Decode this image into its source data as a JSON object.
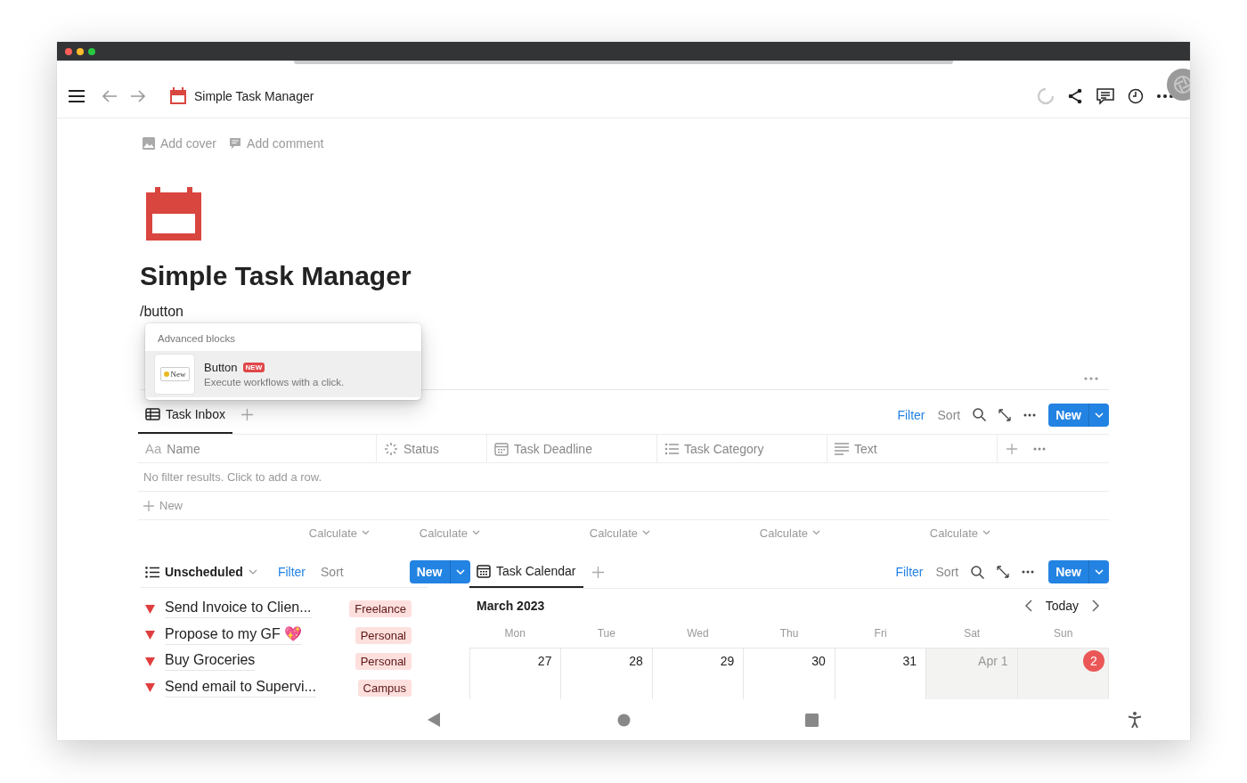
{
  "window": {
    "title": "Simple Task Manager"
  },
  "page_actions": [
    {
      "kind": "cover",
      "label": "Add cover"
    },
    {
      "kind": "comment",
      "label": "Add comment"
    }
  ],
  "page": {
    "title": "Simple Task Manager",
    "typed_command": "/button"
  },
  "block_menu": {
    "section": "Advanced blocks",
    "items": [
      {
        "title": "Button",
        "badge": "NEW",
        "description": "Execute workflows with a click.",
        "preview_label": "New",
        "selected": true
      }
    ]
  },
  "inbox": {
    "tabs": [
      {
        "label": "Task Inbox",
        "selected": true
      }
    ],
    "filter": "Filter",
    "sort": "Sort",
    "new": "New",
    "columns": [
      {
        "kind": "title",
        "prefix": "Aa",
        "label": "Name"
      },
      {
        "kind": "status",
        "label": "Status"
      },
      {
        "kind": "date",
        "label": "Task Deadline"
      },
      {
        "kind": "multi",
        "label": "Task Category"
      },
      {
        "kind": "text",
        "label": "Text"
      }
    ],
    "empty_message": "No filter results. Click to add a row.",
    "add_row": "New",
    "calculate": [
      "Calculate",
      "Calculate",
      "Calculate",
      "Calculate",
      "Calculate"
    ]
  },
  "unscheduled": {
    "view": "Unscheduled",
    "filter": "Filter",
    "sort": "Sort",
    "new": "New",
    "tasks": [
      {
        "name": "Send Invoice to Clien...",
        "tag": "Freelance"
      },
      {
        "name": "Propose to my GF 💖",
        "tag": "Personal"
      },
      {
        "name": "Buy Groceries",
        "tag": "Personal"
      },
      {
        "name": "Send email to Supervi...",
        "tag": "Campus"
      }
    ]
  },
  "calendar": {
    "tabs": [
      {
        "label": "Task Calendar",
        "selected": true
      }
    ],
    "filter": "Filter",
    "sort": "Sort",
    "new": "New",
    "month": "March 2023",
    "today_button": "Today",
    "weekdays": [
      "Mon",
      "Tue",
      "Wed",
      "Thu",
      "Fri",
      "Sat",
      "Sun"
    ],
    "days": [
      {
        "label": "27",
        "weekend": false,
        "other_month": false,
        "today": false
      },
      {
        "label": "28",
        "weekend": false,
        "other_month": false,
        "today": false
      },
      {
        "label": "29",
        "weekend": false,
        "other_month": false,
        "today": false
      },
      {
        "label": "30",
        "weekend": false,
        "other_month": false,
        "today": false
      },
      {
        "label": "31",
        "weekend": false,
        "other_month": false,
        "today": false
      },
      {
        "label": "Apr 1",
        "weekend": true,
        "other_month": true,
        "today": false
      },
      {
        "label": "2",
        "weekend": true,
        "other_month": true,
        "today": true
      }
    ]
  }
}
